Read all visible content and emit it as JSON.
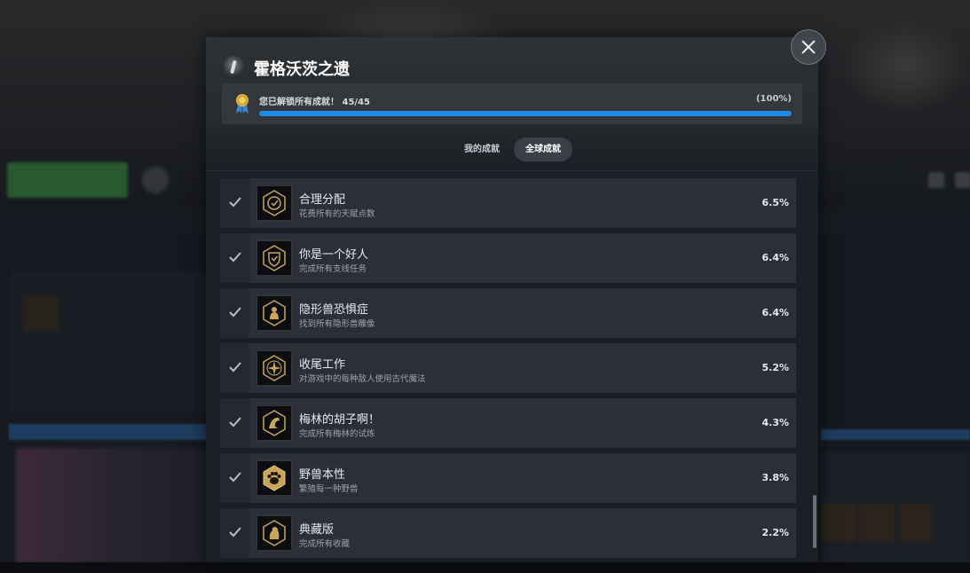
{
  "game": {
    "title": "霍格沃茨之遗",
    "progress_text": "您已解锁所有成就！ 45/45",
    "progress_pct_text": "(100%)",
    "progress_fraction": 1.0
  },
  "tabs": [
    {
      "label": "我的成就",
      "active": false
    },
    {
      "label": "全球成就",
      "active": true
    }
  ],
  "achievements": [
    {
      "name": "合理分配",
      "desc": "花费所有的天赋点数",
      "pct": "6.5%",
      "icon": "talent-badge-icon"
    },
    {
      "name": "你是一个好人",
      "desc": "完成所有支线任务",
      "pct": "6.4%",
      "icon": "shield-check-badge-icon"
    },
    {
      "name": "隐形兽恐惧症",
      "desc": "找到所有隐形兽雕像",
      "pct": "6.4%",
      "icon": "statue-badge-icon"
    },
    {
      "name": "收尾工作",
      "desc": "对游戏中的每种敌人使用古代魔法",
      "pct": "5.2%",
      "icon": "ancient-magic-badge-icon"
    },
    {
      "name": "梅林的胡子啊！",
      "desc": "完成所有梅林的试炼",
      "pct": "4.3%",
      "icon": "merlin-badge-icon"
    },
    {
      "name": "野兽本性",
      "desc": "繁殖每一种野兽",
      "pct": "3.8%",
      "icon": "paw-badge-icon"
    },
    {
      "name": "典藏版",
      "desc": "完成所有收藏",
      "pct": "2.2%",
      "icon": "collection-badge-icon"
    }
  ],
  "colors": {
    "progress_fill": "#1e8ce6",
    "badge_gold": "#c9a55a"
  }
}
